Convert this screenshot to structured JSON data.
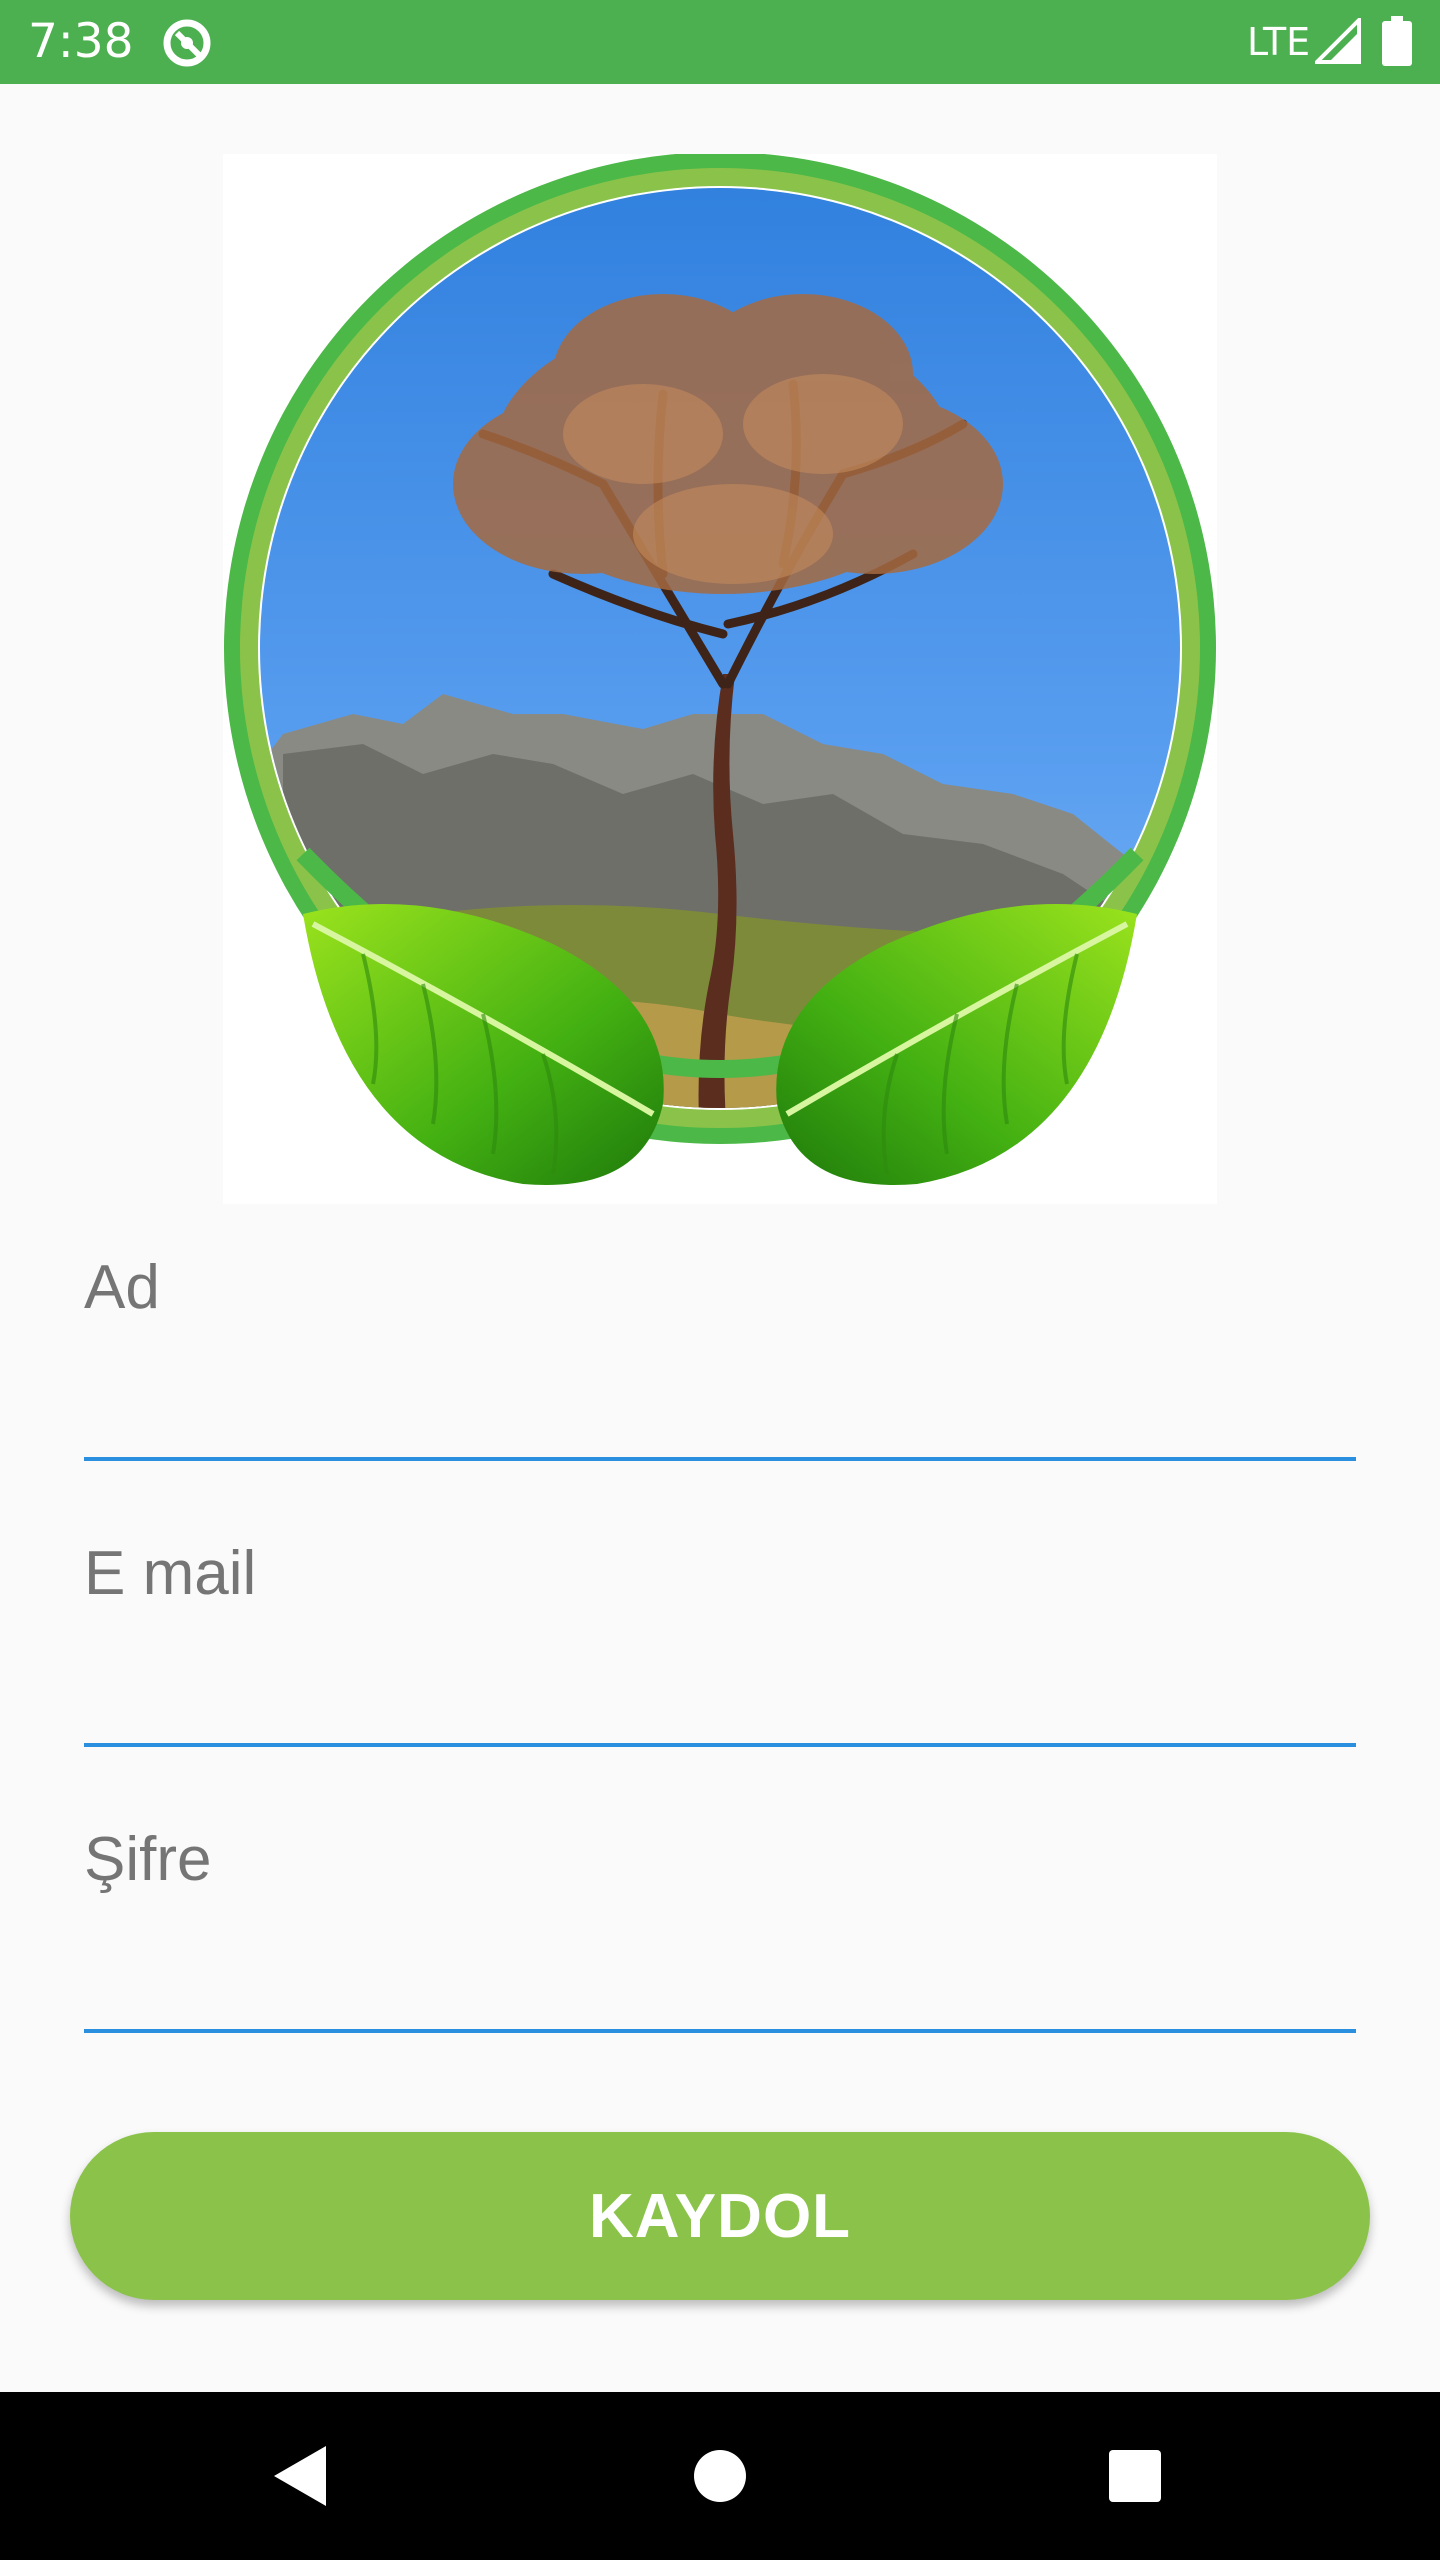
{
  "status_bar": {
    "time": "7:38",
    "network": "LTE",
    "background_color": "#4caf50",
    "icons": [
      "app-notification-icon",
      "signal-icon",
      "battery-icon"
    ]
  },
  "logo": {
    "icon": "tree-logo"
  },
  "form": {
    "name_label": "Ad",
    "email_label": "E mail",
    "password_label": "Şifre",
    "name_value": "",
    "email_value": "",
    "password_value": "",
    "underline_color": "#2b8fe0"
  },
  "register_button": {
    "label": "KAYDOL",
    "color": "#8bc34a"
  },
  "nav_bar": {
    "icons": [
      "back-icon",
      "home-icon",
      "recents-icon"
    ]
  }
}
